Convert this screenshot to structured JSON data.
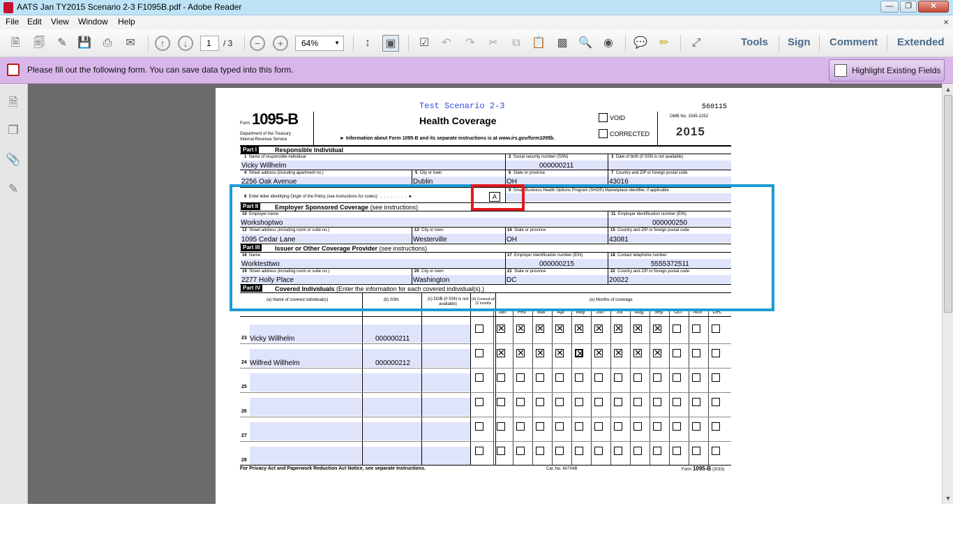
{
  "window": {
    "title": "AATS Jan TY2015 Scenario 2-3 F1095B.pdf - Adobe Reader"
  },
  "menu": {
    "file": "File",
    "edit": "Edit",
    "view": "View",
    "window": "Window",
    "help": "Help",
    "close": "×"
  },
  "toolbar": {
    "page_current": "1",
    "page_total": "/ 3",
    "zoom": "64%",
    "tools": "Tools",
    "sign": "Sign",
    "comment": "Comment",
    "extended": "Extended"
  },
  "notice": {
    "text": "Please fill out the following form. You can save data typed into this form.",
    "highlight": "Highlight Existing Fields"
  },
  "form": {
    "scenario": "Test Scenario 2-3",
    "code": "560115",
    "form_word": "Form",
    "form_number": "1095-B",
    "dept": "Department of the Treasury",
    "irs": "Internal Revenue Service",
    "title": "Health Coverage",
    "info": "Information about Form 1095-B and its separate instructions is at",
    "info_url": "www.irs.gov/form1095b.",
    "void": "VOID",
    "corrected": "CORRECTED",
    "omb": "OMB No. 1545-2252",
    "year": "2015",
    "part1": {
      "tag": "Part I",
      "title": "Responsible Individual",
      "l1": "Name of responsible individual",
      "l2": "Social security number (SSN)",
      "l3": "Date of birth (if SSN is not available)",
      "l4": "Street address (including apartment no.)",
      "l5": "City or town",
      "l6": "State or province",
      "l7": "Country and ZIP or foreign postal code",
      "l8": "Enter letter identifying Origin of the Policy (see instructions for codes):",
      "l9": "Small Business Health Options Program (SHOP) Marketplace identifier, if applicable",
      "name": "Vicky Willhelm",
      "ssn": "000000211",
      "street": "2256 Oak Avenue",
      "city": "Dublin",
      "state": "OH",
      "zip": "43016",
      "origin": "A"
    },
    "part2": {
      "tag": "Part II",
      "title": "Employer Sponsored Coverage",
      "note": "(see instructions)",
      "l10": "Employer name",
      "l11": "Employer identification number (EIN)",
      "l12": "Street address (including room or suite no.)",
      "l13": "City or town",
      "l14": "State or province",
      "l15": "Country and ZIP or foreign postal code",
      "name": "Workshoptwo",
      "ein": "000000250",
      "street": "1095 Cedar Lane",
      "city": "Westerville",
      "state": "OH",
      "zip": "43081"
    },
    "part3": {
      "tag": "Part III",
      "title": "Issuer or Other Coverage Provider",
      "note": "(see instructions)",
      "l16": "Name",
      "l17": "Employer identification number (EIN)",
      "l18": "Contact telephone number",
      "l19": "Street address (including room or suite no.)",
      "l20": "City or town",
      "l21": "State or province",
      "l22": "Country and ZIP or foreign postal code",
      "name": "Worktesttwo",
      "ein": "000000215",
      "phone": "5555372511",
      "street": "2277 Holly Place",
      "city": "Washington",
      "state": "DC",
      "zip": "20022"
    },
    "part4": {
      "tag": "Part IV",
      "title": "Covered Individuals",
      "note": "(Enter the information for each covered individual(s).)",
      "ca": "(a) Name of covered individual(s)",
      "cb": "(b) SSN",
      "cc": "(c) DOB (if SSN is not available)",
      "cd": "(d) Covered all 12 months",
      "ce": "(e) Months of coverage",
      "months": [
        "Jan",
        "Feb",
        "Mar",
        "Apr",
        "May",
        "Jun",
        "Jul",
        "Aug",
        "Sep",
        "Oct",
        "Nov",
        "Dec"
      ],
      "rows": [
        {
          "num": "23",
          "name": "Vicky Willhelm",
          "ssn": "000000211",
          "all12": false,
          "checks": [
            true,
            true,
            true,
            true,
            true,
            true,
            true,
            true,
            true,
            false,
            false,
            false
          ]
        },
        {
          "num": "24",
          "name": "Wilfred Willhelm",
          "ssn": "000000212",
          "all12": false,
          "checks": [
            true,
            true,
            true,
            true,
            true,
            true,
            true,
            true,
            true,
            false,
            false,
            false
          ]
        },
        {
          "num": "25",
          "name": "",
          "ssn": "",
          "all12": false,
          "checks": [
            false,
            false,
            false,
            false,
            false,
            false,
            false,
            false,
            false,
            false,
            false,
            false
          ]
        },
        {
          "num": "26",
          "name": "",
          "ssn": "",
          "all12": false,
          "checks": [
            false,
            false,
            false,
            false,
            false,
            false,
            false,
            false,
            false,
            false,
            false,
            false
          ]
        },
        {
          "num": "27",
          "name": "",
          "ssn": "",
          "all12": false,
          "checks": [
            false,
            false,
            false,
            false,
            false,
            false,
            false,
            false,
            false,
            false,
            false,
            false
          ]
        },
        {
          "num": "28",
          "name": "",
          "ssn": "",
          "all12": false,
          "checks": [
            false,
            false,
            false,
            false,
            false,
            false,
            false,
            false,
            false,
            false,
            false,
            false
          ]
        }
      ]
    },
    "footer": {
      "privacy": "For Privacy Act and Paperwork Reduction Act Notice, see separate instructions.",
      "cat": "Cat. No. 60704B",
      "form": "Form",
      "form_no": "1095-B",
      "year": "(2015)"
    }
  }
}
